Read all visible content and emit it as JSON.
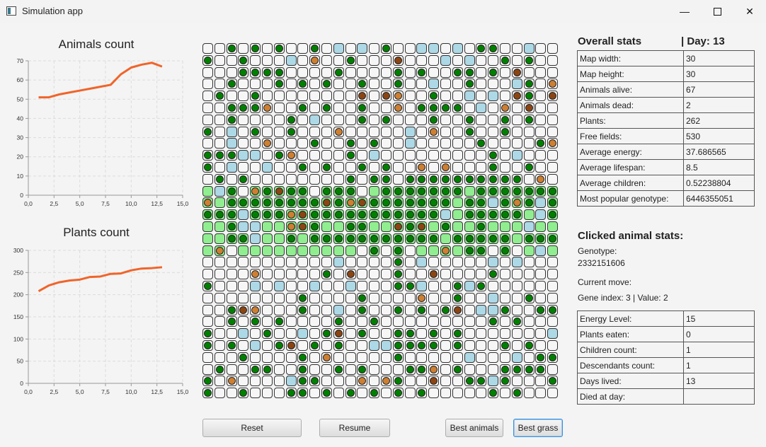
{
  "window": {
    "title": "Simulation app",
    "icon": "app-window-icon",
    "controls": [
      "minimize-icon",
      "maximize-icon",
      "close-icon"
    ]
  },
  "charts": {
    "animals_title": "Animals count",
    "plants_title": "Plants count"
  },
  "chart_data": [
    {
      "type": "line",
      "title": "Animals count",
      "color": "#f0642a",
      "x": [
        1,
        2,
        3,
        4,
        5,
        6,
        7,
        8,
        9,
        10,
        11,
        12,
        13
      ],
      "values": [
        51,
        51,
        52.5,
        53.5,
        54.5,
        55.5,
        56.5,
        57.5,
        63,
        66.5,
        68,
        69,
        67
      ],
      "xlim": [
        0,
        15
      ],
      "ylim": [
        0,
        70
      ],
      "xticks": [
        "0,0",
        "2,5",
        "5,0",
        "7,5",
        "10,0",
        "12,5",
        "15,0"
      ],
      "xtick_values": [
        0,
        2.5,
        5,
        7.5,
        10,
        12.5,
        15
      ],
      "yticks": [
        "0",
        "10",
        "20",
        "30",
        "40",
        "50",
        "60",
        "70"
      ],
      "ytick_values": [
        0,
        10,
        20,
        30,
        40,
        50,
        60,
        70
      ],
      "grid": true
    },
    {
      "type": "line",
      "title": "Plants count",
      "color": "#f0642a",
      "x": [
        1,
        2,
        3,
        4,
        5,
        6,
        7,
        8,
        9,
        10,
        11,
        12,
        13
      ],
      "values": [
        208,
        221,
        228,
        232,
        234,
        240,
        241,
        247,
        248,
        255,
        259,
        260,
        262
      ],
      "xlim": [
        0,
        15
      ],
      "ylim": [
        0,
        300
      ],
      "xticks": [
        "0,0",
        "2,5",
        "5,0",
        "7,5",
        "10,0",
        "12,5",
        "15,0"
      ],
      "xtick_values": [
        0,
        2.5,
        5,
        7.5,
        10,
        12.5,
        15
      ],
      "yticks": [
        "0",
        "50",
        "100",
        "150",
        "200",
        "250",
        "300"
      ],
      "ytick_values": [
        0,
        50,
        100,
        150,
        200,
        250,
        300
      ],
      "grid": true
    }
  ],
  "map": {
    "cols": 30,
    "rows": 30,
    "grass_rows": [
      12,
      13,
      14,
      15,
      16,
      17
    ],
    "legend": {
      "empty": "#f6f6f6",
      "grass": "#90ee90",
      "water": "#add8e6",
      "plant": "#008000",
      "animal_orange": "#cd7f32",
      "animal_brown": "#8b4513",
      "animal_dark": "#5a2a0a"
    },
    "rows_data": [
      "..P.P.P..P.W.W.P..WW.W.PP..W..",
      "P..P...W.O..P...D...W.W..P.P..",
      "...PPPP....P....P.P..PP.P.D...",
      "..P...P.P.P..P..P..W..P...WP.O",
      ".P..P........D.DO..P..W.W.DP.D",
      "..PPPO..P.P..P..O.PPPP.W.O.D..",
      "..P....P.W...P.P...P..P..P.P..",
      "P.W.P..P...O.....W.O..P..P....",
      "..W..O...P..P.P..W.....P....PO",
      "PPPWW.PO....P.W.........P.W...",
      "P.W..W..P.P..P.P..O.O...P..P..",
      ".P.P........P.PP.PPPPPPPPPP.O.",
      "GWP.OPDPP.PPP.GPPPPPPPGPPPPPPP",
      "OGPPPPPPPPDPODPPPPPPPGPPWPOPWP",
      "PPPWPPPODPPPPPPPPPPPWGPPPPPGWP",
      "GGPWWGGODPGGPPGGDPDGPGGPGGGWGG",
      "GGPPWGGPGPPPPPPPPPPPGPPPPPGPPP",
      "GO.GGGGGGGGGG.P.P.GGOGPP.P.GWG",
      "...........W....P.W.....W.W...",
      "....O.....P.D...P..D....P.....",
      "P...W.W..W..W...PPW..PWP......",
      "........P....P....O..P..W..P..",
      "..PDO...P..W.P..P.P.PD.WWP..PP",
      "..P.P.P....P..P.........P.P...",
      "P..W.P..W.PD.P..PP.P.P.......W",
      "P.P.W.PD.P.P..WWPPPP.P...P.P..",
      "...P....P.O.....P.....W...W.PP",
      ".P..PP..P..P.P...PPO.P...PPPP.",
      "P.O....WPP...O.OP..D..PPWP...P",
      "P..P...PP.P.P.P.P.P.....P.P..."
    ]
  },
  "overall": {
    "heading": "Overall stats",
    "day": "| Day: 13",
    "rows": [
      {
        "label": "Map width:",
        "value": "30"
      },
      {
        "label": "Map height:",
        "value": "30"
      },
      {
        "label": "Animals alive:",
        "value": "67"
      },
      {
        "label": "Animals dead:",
        "value": "2"
      },
      {
        "label": "Plants:",
        "value": "262"
      },
      {
        "label": "Free fields:",
        "value": "530"
      },
      {
        "label": "Average energy:",
        "value": "37.686565"
      },
      {
        "label": "Average lifespan:",
        "value": "8.5"
      },
      {
        "label": "Average children:",
        "value": "0.52238804"
      },
      {
        "label": "Most popular genotype:",
        "value": "6446355051"
      }
    ]
  },
  "clicked": {
    "heading": "Clicked animal stats:",
    "genotype_label": "Genotype:",
    "genotype_value": "2332151606",
    "move_label": "Current move:",
    "gene_line": "Gene index: 3 | Value: 2",
    "rows": [
      {
        "label": "Energy Level:",
        "value": "15"
      },
      {
        "label": "Plants eaten:",
        "value": "0"
      },
      {
        "label": "Children count:",
        "value": "1"
      },
      {
        "label": "Descendants count:",
        "value": "1"
      },
      {
        "label": "Days lived:",
        "value": "13"
      },
      {
        "label": "Died at day:",
        "value": ""
      }
    ]
  },
  "buttons": {
    "reset": "Reset",
    "resume": "Resume",
    "best_animals": "Best animals",
    "best_grass": "Best grass"
  }
}
